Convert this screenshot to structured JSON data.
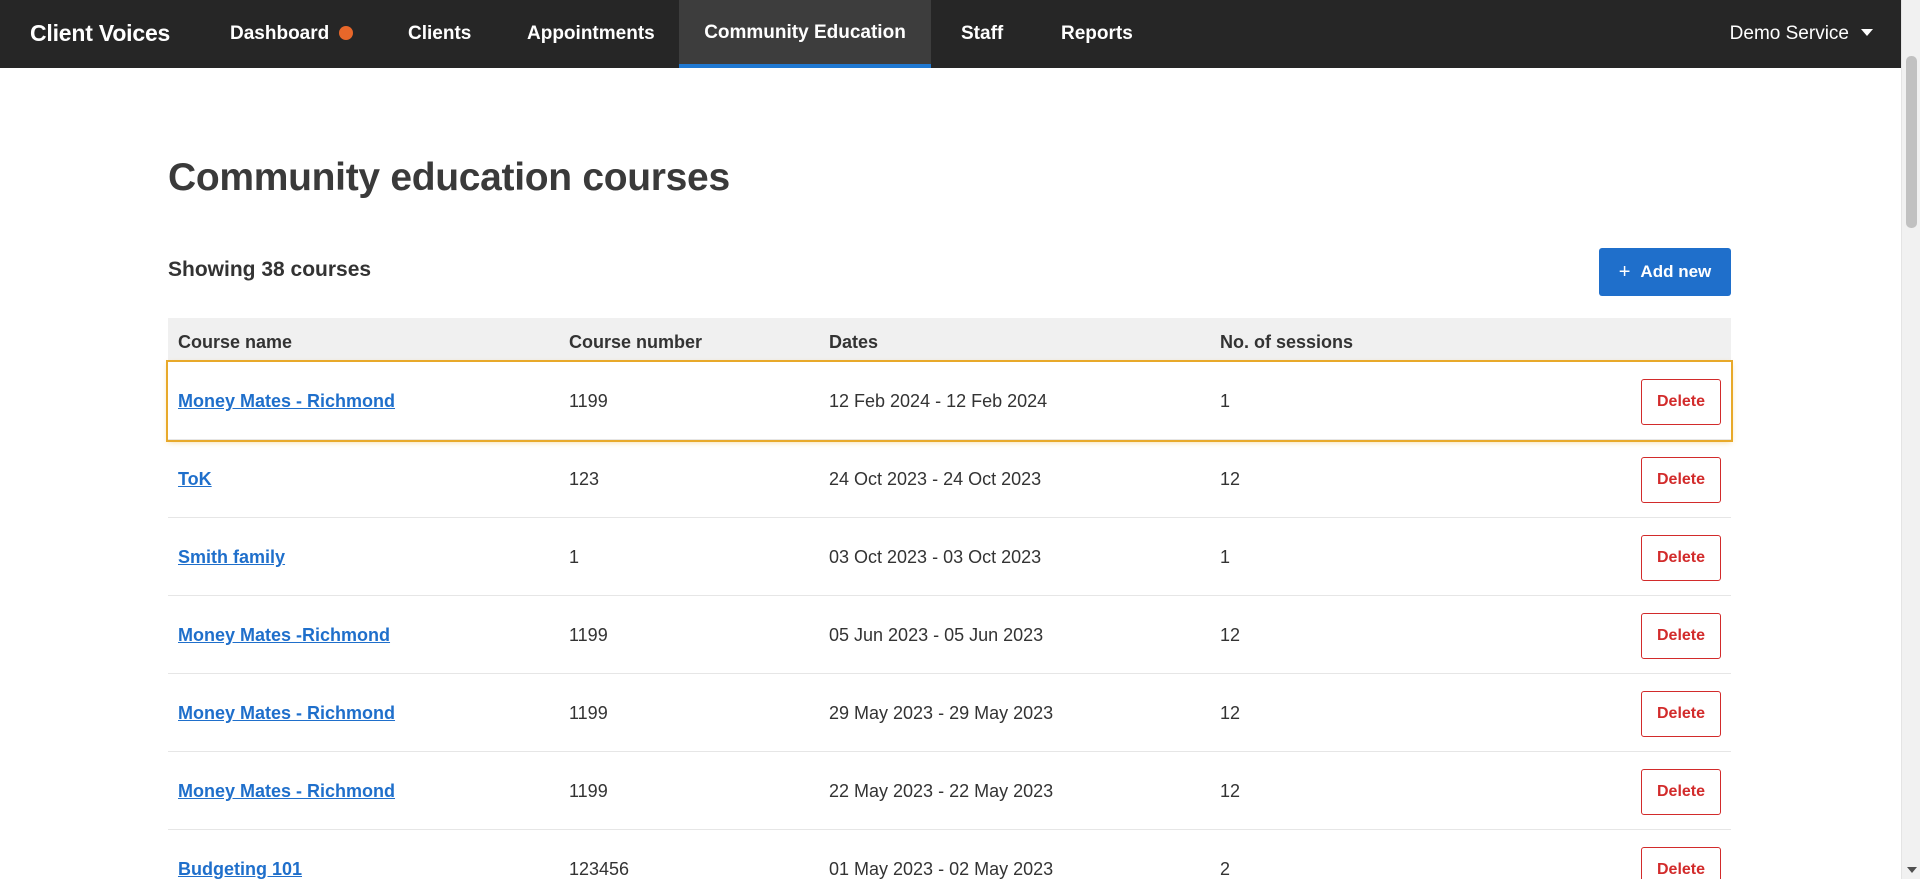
{
  "app": {
    "brand": "Client Voices",
    "service_menu": "Demo Service",
    "accent_color": "#1f78d1",
    "notification_color": "#e8672a"
  },
  "nav": {
    "items": [
      {
        "label": "Dashboard",
        "has_notification": true
      },
      {
        "label": "Clients"
      },
      {
        "label": "Appointments"
      },
      {
        "label": "Community Education",
        "active": true
      },
      {
        "label": "Staff"
      },
      {
        "label": "Reports"
      }
    ]
  },
  "page": {
    "title": "Community education courses",
    "count_text": "Showing 38 courses",
    "add_button": "Add new"
  },
  "table": {
    "columns": [
      "Course name",
      "Course number",
      "Dates",
      "No. of sessions"
    ],
    "delete_label": "Delete",
    "rows": [
      {
        "name": "Money Mates - Richmond",
        "number": "1199",
        "dates": "12 Feb 2024 - 12 Feb 2024",
        "sessions": "1",
        "highlighted": true
      },
      {
        "name": "ToK",
        "number": "123",
        "dates": "24 Oct 2023 - 24 Oct 2023",
        "sessions": "12"
      },
      {
        "name": "Smith family",
        "number": "1",
        "dates": "03 Oct 2023 - 03 Oct 2023",
        "sessions": "1"
      },
      {
        "name": "Money Mates -Richmond",
        "number": "1199",
        "dates": "05 Jun 2023 - 05 Jun 2023",
        "sessions": "12"
      },
      {
        "name": "Money Mates - Richmond",
        "number": "1199",
        "dates": "29 May 2023 - 29 May 2023",
        "sessions": "12"
      },
      {
        "name": "Money Mates - Richmond",
        "number": "1199",
        "dates": "22 May 2023 - 22 May 2023",
        "sessions": "12"
      },
      {
        "name": "Budgeting 101",
        "number": "123456",
        "dates": "01 May 2023 - 02 May 2023",
        "sessions": "2"
      }
    ]
  }
}
